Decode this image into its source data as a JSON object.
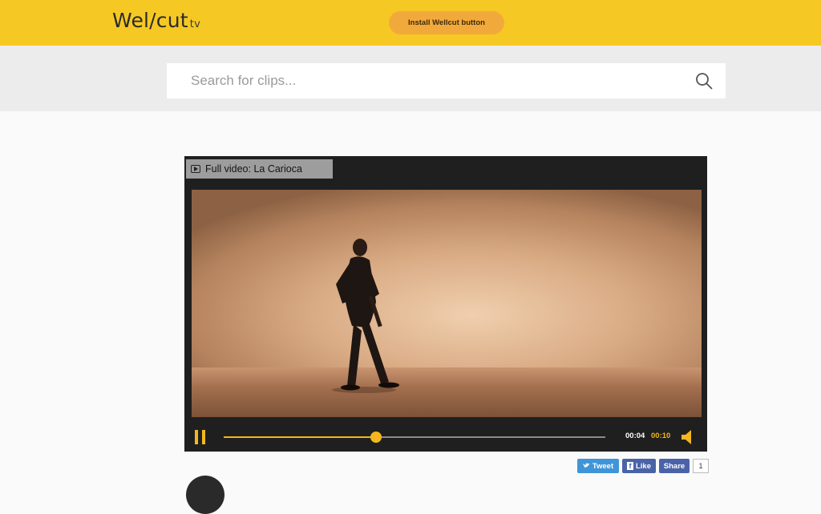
{
  "header": {
    "logo_text": "Wel/cut",
    "logo_tld": "tv",
    "install_button": "Install Wellcut button",
    "bg_color": "#f6c823"
  },
  "search": {
    "placeholder": "Search for clips..."
  },
  "player": {
    "full_video_label": "Full video: La Carioca",
    "current_time": "00:04",
    "duration": "00:10",
    "progress": 0.4,
    "accent_color": "#f2b81e"
  },
  "share": {
    "tweet": "Tweet",
    "like": "Like",
    "share": "Share",
    "count": "1"
  },
  "icons": {
    "search": "search-icon",
    "pause": "pause-icon",
    "volume": "volume-icon",
    "play_square": "play-square-icon",
    "twitter": "twitter-icon",
    "facebook": "facebook-icon"
  }
}
